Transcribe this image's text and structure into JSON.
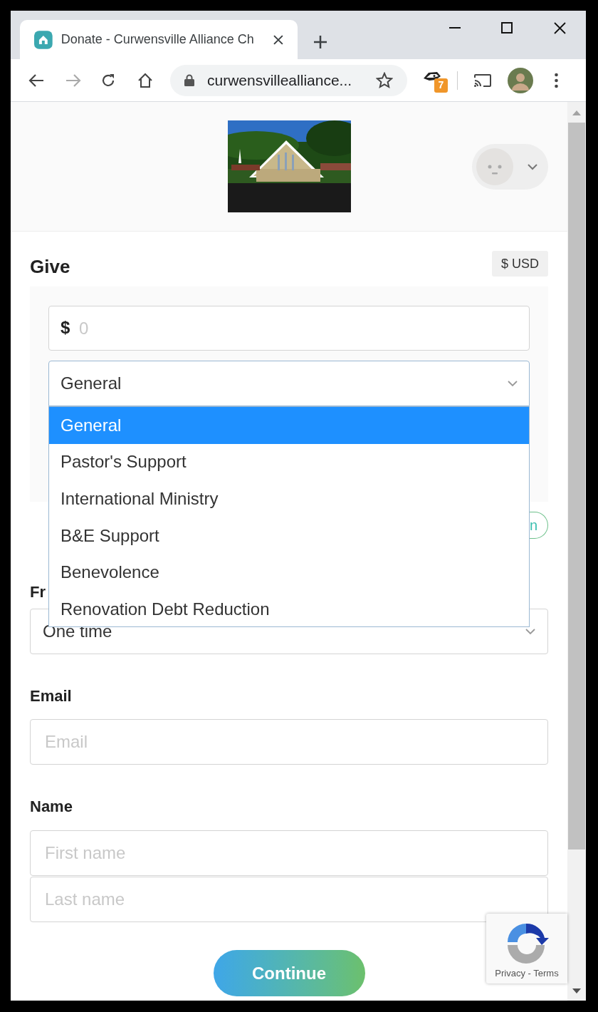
{
  "browser": {
    "tab_title": "Donate - Curwensville Alliance Ch",
    "address": "curwensvillealliance...",
    "extension_badge": "7"
  },
  "give": {
    "title": "Give",
    "currency": "$ USD",
    "amount": {
      "prefix": "$",
      "placeholder": "0"
    },
    "fund": {
      "value": "General",
      "expanded": true,
      "options": [
        {
          "label": "General",
          "selected": true
        },
        {
          "label": "Pastor's Support",
          "selected": false
        },
        {
          "label": "International Ministry",
          "selected": false
        },
        {
          "label": "B&E Support",
          "selected": false
        },
        {
          "label": "Benevolence",
          "selected": false
        },
        {
          "label": "Renovation Debt Reduction",
          "selected": false
        }
      ]
    },
    "partial_button": "n"
  },
  "frequency": {
    "label": "Fr",
    "value": "One time"
  },
  "email": {
    "label": "Email",
    "placeholder": "Email"
  },
  "name": {
    "label": "Name",
    "first_placeholder": "First name",
    "last_placeholder": "Last name"
  },
  "continue": "Continue",
  "recaptcha": "Privacy - Terms"
}
